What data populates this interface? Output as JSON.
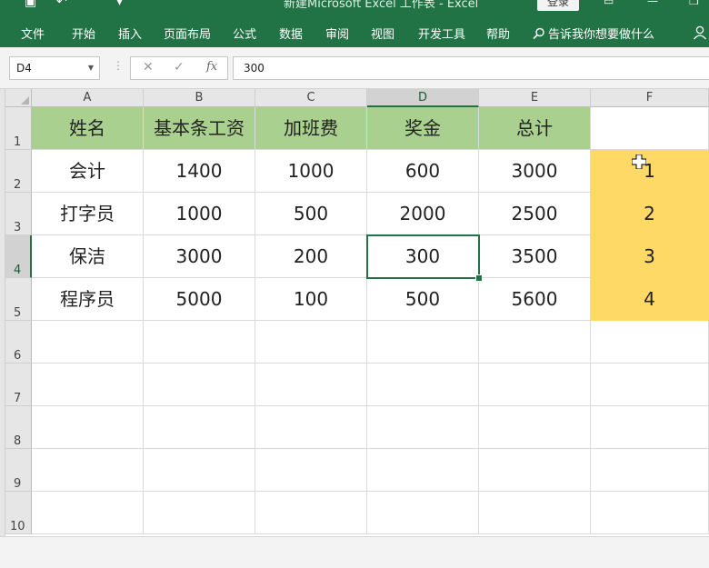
{
  "ribbon": {
    "title": "新建Microsoft Excel 工作表 - Excel",
    "login_label": "登录",
    "tabs": [
      "文件",
      "开始",
      "插入",
      "页面布局",
      "公式",
      "数据",
      "审阅",
      "视图",
      "开发工具",
      "帮助"
    ],
    "tell_me": "告诉我你想要做什么",
    "colors": {
      "ribbon": "#217346"
    }
  },
  "formula_bar": {
    "name_box": "D4",
    "cancel_icon": "✕",
    "enter_icon": "✓",
    "fx_label": "fx",
    "value": "300"
  },
  "sheet": {
    "columns": [
      "A",
      "B",
      "C",
      "D",
      "E",
      "F"
    ],
    "rows": [
      "1",
      "2",
      "3",
      "4",
      "5",
      "6",
      "7",
      "8",
      "9",
      "10"
    ],
    "selected_cell": "D4",
    "header_row": [
      "姓名",
      "基本条工资",
      "加班费",
      "奖金",
      "总计"
    ],
    "data_rows": [
      [
        "会计",
        "1400",
        "1000",
        "600",
        "3000",
        "1"
      ],
      [
        "打字员",
        "1000",
        "500",
        "2000",
        "2500",
        "2"
      ],
      [
        "保洁",
        "3000",
        "200",
        "300",
        "3500",
        "3"
      ],
      [
        "程序员",
        "5000",
        "100",
        "500",
        "5600",
        "4"
      ]
    ],
    "colors": {
      "header_fill": "#a9d08e",
      "f_fill": "#ffd966",
      "selection": "#217346"
    }
  }
}
